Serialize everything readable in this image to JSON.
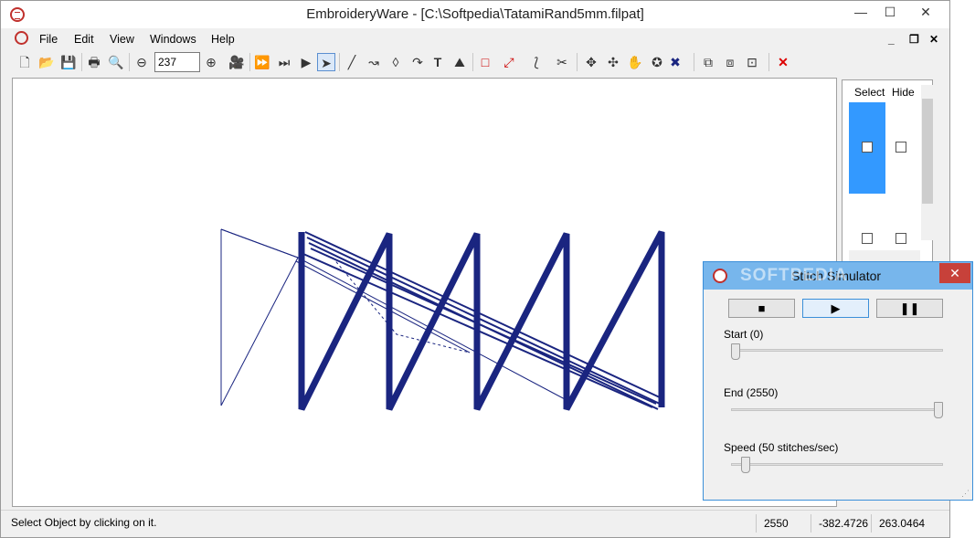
{
  "window": {
    "app_name": "EmbroideryWare",
    "title": "EmbroideryWare - [C:\\Softpedia\\TatamiRand5mm.filpat]",
    "controls": {
      "minimize": "—",
      "maximize": "☐",
      "close": "✕"
    },
    "mdi_controls": {
      "minimize": "_",
      "restore": "❐",
      "close": "✕"
    }
  },
  "menu": [
    {
      "label": "File"
    },
    {
      "label": "Edit"
    },
    {
      "label": "View"
    },
    {
      "label": "Windows"
    },
    {
      "label": "Help"
    }
  ],
  "toolbar": {
    "zoom_value": "237",
    "icons": [
      "new-icon",
      "open-icon",
      "save-icon",
      "print-icon",
      "print-preview-icon",
      "zoom-out-icon",
      "zoom-in-icon",
      "camera-icon",
      "fast-forward-icon",
      "skip-icon",
      "play-icon",
      "select-arrow-icon",
      "line-icon",
      "curve-icon",
      "shape-icon",
      "arc-icon",
      "text-icon",
      "fill-icon",
      "rectangle-icon",
      "node-icon",
      "wave-icon",
      "cut-icon",
      "move-icon",
      "pan-icon",
      "hand-icon",
      "stitch-icon",
      "group-icon",
      "ungroup-icon",
      "frame-icon",
      "delete-icon"
    ]
  },
  "layers_panel": {
    "columns": [
      "Select",
      "Hide"
    ]
  },
  "status_bar": {
    "message": "Select Object by clicking on it.",
    "stitches": "2550",
    "x": "-382.4726",
    "y": "263.0464"
  },
  "stitch_simulator": {
    "title": "Stitch Simulator",
    "watermark": "SOFTPEDIA",
    "buttons": {
      "stop": "■",
      "play": "▶",
      "pause": "❚❚"
    },
    "start_label": "Start (0)",
    "end_label": "End (2550)",
    "speed_label": "Speed (50 stitches/sec)",
    "start_value": 0,
    "end_value": 2550,
    "end_max": 2550,
    "speed_value": 50
  },
  "colors": {
    "stitch": "#1a2580",
    "selection": "#3399ff",
    "dialog_title": "#77b6ec",
    "close_red": "#c7413a"
  }
}
